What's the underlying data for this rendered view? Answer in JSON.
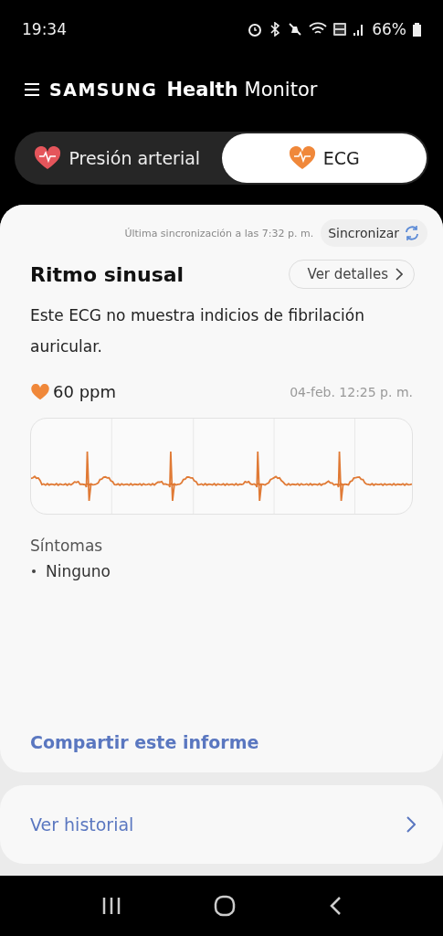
{
  "status_bar": {
    "time": "19:34",
    "battery": "66%"
  },
  "header": {
    "brand": "SAMSUNG",
    "app": "Health",
    "suffix": "Monitor"
  },
  "tabs": [
    {
      "label": "Presión arterial",
      "kind": "pressure",
      "selected": false
    },
    {
      "label": "ECG",
      "kind": "ecg",
      "selected": true
    }
  ],
  "result_card": {
    "sync_text": "Última sincronización a las 7:32 p. m.",
    "sync_button": "Sincronizar",
    "title": "Ritmo sinusal",
    "details_button": "Ver detalles",
    "description": "Este ECG no muestra indicios de fibrilación auricular.",
    "heart_rate": "60 ppm",
    "timestamp": "04-feb. 12:25 p. m.",
    "symptoms_label": "Síntomas",
    "symptoms": [
      "Ninguno"
    ],
    "share_link": "Compartir este informe"
  },
  "history_link": "Ver historial"
}
